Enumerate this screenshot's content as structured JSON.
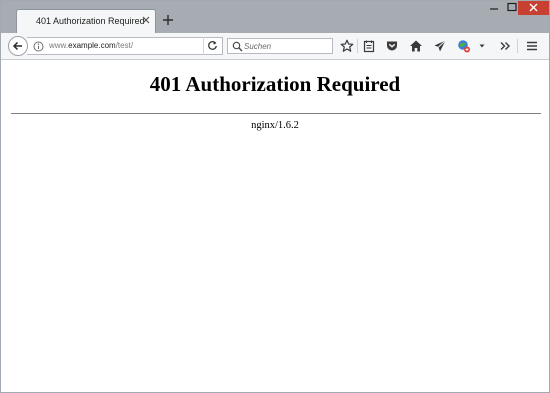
{
  "browser": {
    "tab": {
      "title": "401 Authorization Required"
    },
    "url": {
      "scheme_host_prefix": "www.",
      "host": "example.com",
      "path": "/test/"
    },
    "search": {
      "placeholder": "Suchen"
    },
    "toolbar_icons": [
      "bookmark-star-icon",
      "reading-list-icon",
      "pocket-icon",
      "home-icon",
      "send-icon",
      "extension-icon",
      "overflow-icon",
      "menu-icon"
    ],
    "colors": {
      "titlebar": "#a7acb3",
      "toolbar": "#f5f6f7",
      "close_button": "#c84031"
    }
  },
  "page": {
    "heading": "401 Authorization Required",
    "server": "nginx/1.6.2"
  }
}
